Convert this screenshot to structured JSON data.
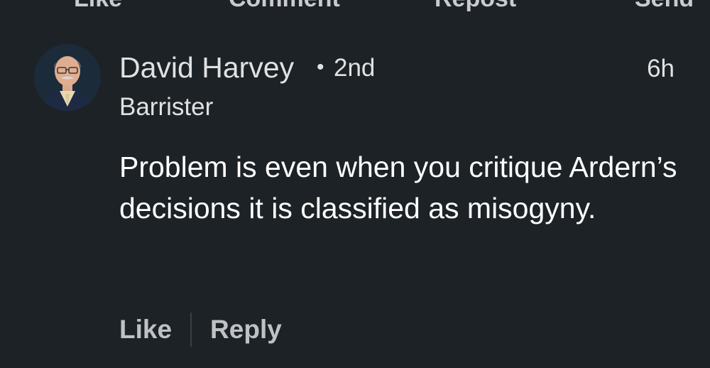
{
  "post_actions": {
    "like_label": "Like",
    "comment_label": "Comment",
    "repost_label": "Repost",
    "send_label": "Send"
  },
  "comment": {
    "author_name": "David Harvey",
    "separator": "•",
    "connection_degree": "2nd",
    "timestamp": "6h",
    "author_headline": "Barrister",
    "text": "Problem is even when you critique Ardern’s decisions it is classified as misogyny.",
    "actions": {
      "like_label": "Like",
      "reply_label": "Reply"
    }
  }
}
